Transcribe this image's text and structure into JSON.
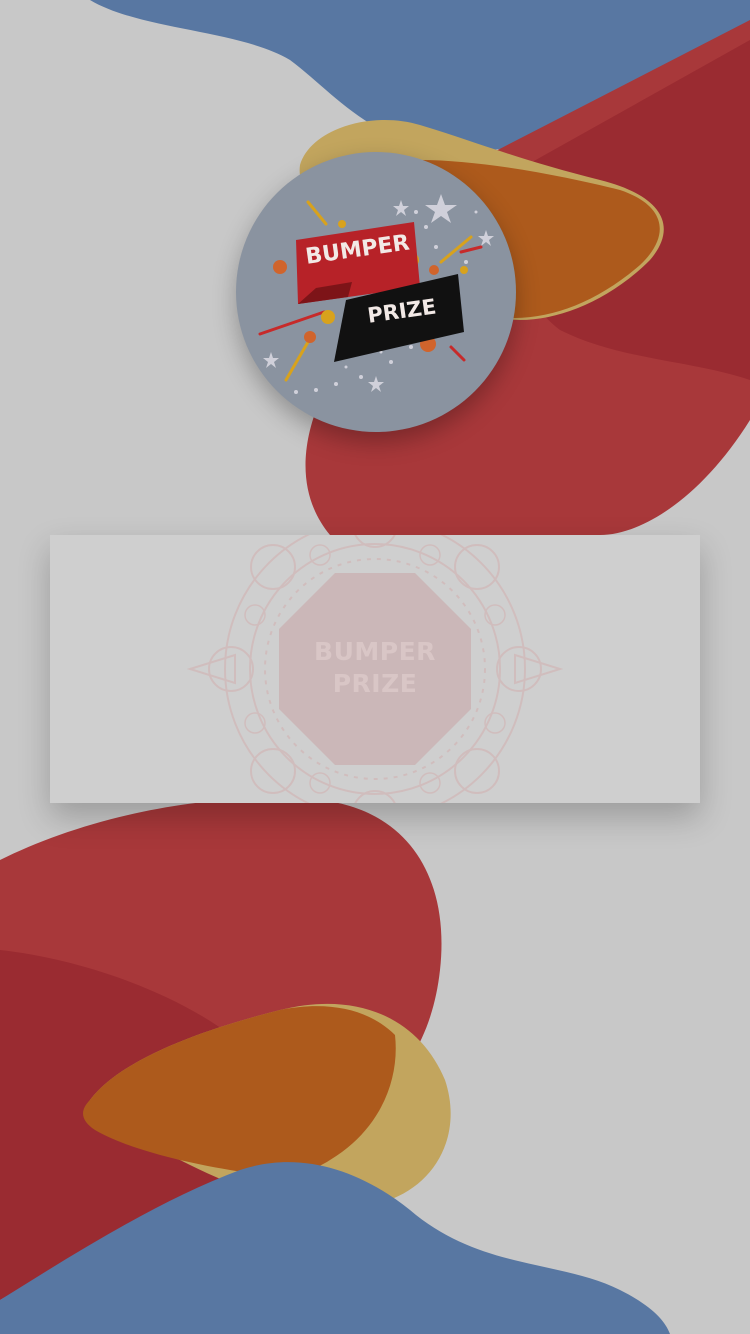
{
  "badge": {
    "line1": "BUMPER",
    "line2": "PRIZE"
  },
  "scratch_card": {
    "line1": "BUMPER",
    "line2": "PRIZE"
  },
  "colors": {
    "background": "#c8c8c8",
    "blue": "#5877a2",
    "red": "#a8383a",
    "dark_red": "#9a2b31",
    "orange": "#ad5a1c",
    "gold": "#c2a55e",
    "badge_fill": "#8a93a0",
    "ribbon_red": "#b72228",
    "ribbon_black": "#111111"
  }
}
